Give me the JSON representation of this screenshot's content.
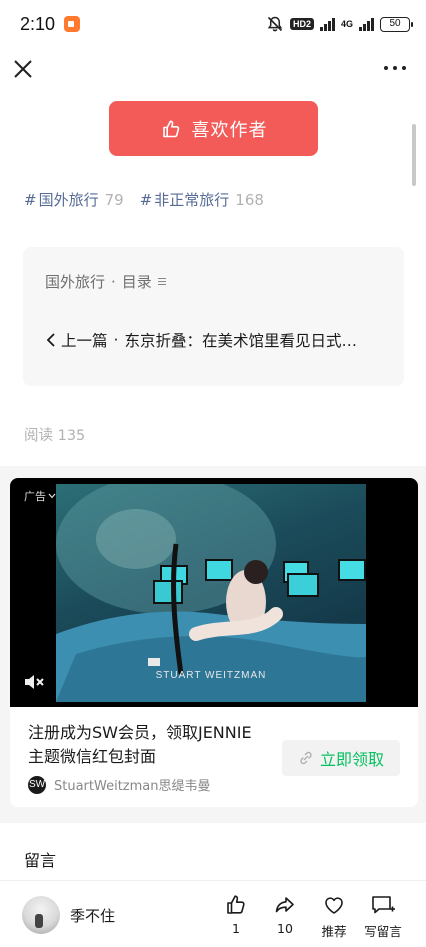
{
  "status_bar": {
    "time": "2:10",
    "hd_badge": "HD2",
    "network": "4G",
    "battery": "50"
  },
  "nav": {
    "close_icon": "close-icon",
    "more_icon": "more-icon"
  },
  "like_author": {
    "label": "喜欢作者",
    "icon": "thumbs-up-icon",
    "color": "#f25b58"
  },
  "tags": [
    {
      "hash": "#",
      "name": "国外旅行",
      "count": "79"
    },
    {
      "hash": "#",
      "name": "非正常旅行",
      "count": "168"
    }
  ],
  "catalog": {
    "collection": "国外旅行",
    "separator": "·",
    "catalog_label": "目录",
    "prev_label": "上一篇",
    "prev_sep": "·",
    "prev_title": "东京折叠：在美术馆里看见日式…"
  },
  "read_count": {
    "label": "阅读",
    "value": "135"
  },
  "ad": {
    "badge": "广告",
    "overlay_brand": "STUART WEITZMAN",
    "text_line1": "注册成为SW会员，领取JENNIE",
    "text_line2": "主题微信红包封面",
    "cta_label": "立即领取",
    "cta_color": "#07c160",
    "brand_logo": "SW",
    "brand_name": "StuartWeitzman思缇韦曼"
  },
  "comments": {
    "title": "留言"
  },
  "bottom_bar": {
    "author_name": "季不住",
    "actions": [
      {
        "icon": "thumbs-up-icon",
        "label": "1"
      },
      {
        "icon": "share-icon",
        "label": "10"
      },
      {
        "icon": "heart-icon",
        "label": "推荐"
      },
      {
        "icon": "comment-icon",
        "label": "写留言"
      }
    ]
  }
}
